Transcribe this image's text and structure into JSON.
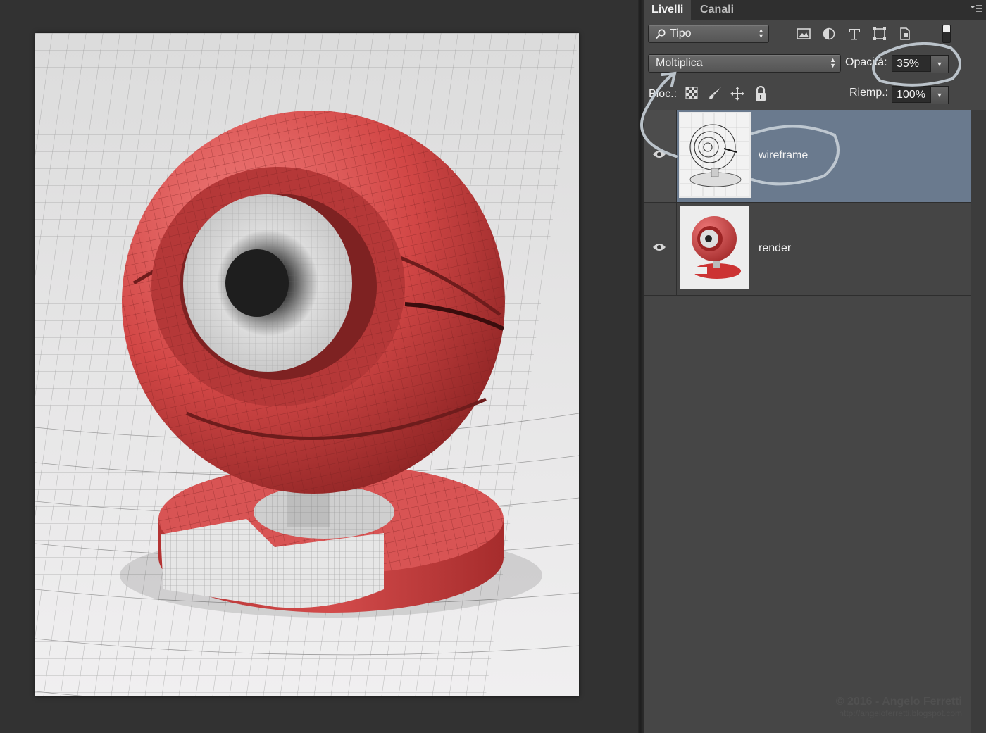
{
  "tabs": [
    {
      "label": "Livelli",
      "active": true
    },
    {
      "label": "Canali",
      "active": false
    }
  ],
  "filter": {
    "value": "Tipo",
    "icon": "search-icon"
  },
  "filter_icons": [
    "image-filter-icon",
    "adjustment-filter-icon",
    "type-filter-icon",
    "shape-filter-icon",
    "smart-object-filter-icon"
  ],
  "blend_mode": {
    "value": "Moltiplica"
  },
  "opacity": {
    "label": "Opacità:",
    "value": "35%"
  },
  "lock": {
    "label": "Bloc.:",
    "icons": [
      "lock-transparent-pixels-icon",
      "lock-image-pixels-icon",
      "lock-position-icon",
      "lock-all-icon"
    ]
  },
  "fill": {
    "label": "Riemp.:",
    "value": "100%"
  },
  "layers": [
    {
      "name": "wireframe",
      "visible": true,
      "selected": true
    },
    {
      "name": "render",
      "visible": true,
      "selected": false
    }
  ],
  "watermark": {
    "line1": "© 2016 - Angelo Ferretti",
    "line2": "http://angeloferretti.blogspot.com"
  },
  "colors": {
    "selection": "#6a7a8e",
    "panel": "#464646",
    "object_red": "#d14b4b"
  }
}
